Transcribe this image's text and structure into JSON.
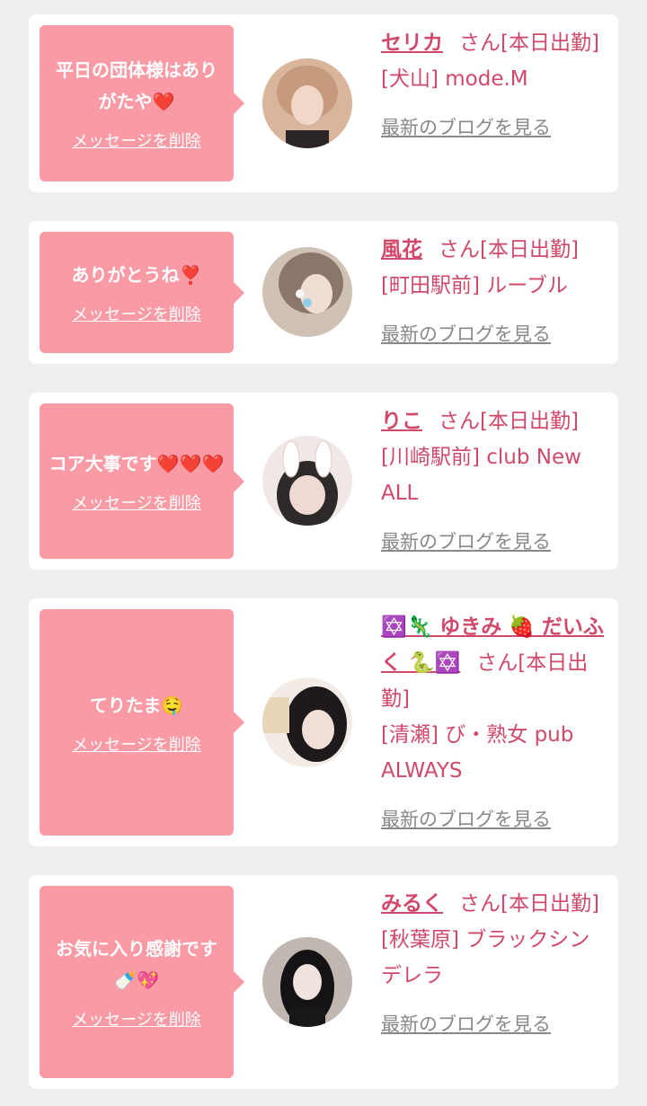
{
  "cards": [
    {
      "message": "平日の団体様はありがたや❤️",
      "delete_label": "メッセージを削除",
      "name": "セリカ",
      "suffix": "さん[本日出勤]",
      "shop": "[犬山] mode.M",
      "blog_label": "最新のブログを見る",
      "avatar_colors": [
        "#d9b59c",
        "#5a4a44"
      ]
    },
    {
      "message": "ありがとうね❣️",
      "delete_label": "メッセージを削除",
      "name": "風花",
      "suffix": "さん[本日出勤]",
      "shop": "[町田駅前] ルーブル",
      "blog_label": "最新のブログを見る",
      "avatar_colors": [
        "#cfc2b5",
        "#7b6a60"
      ]
    },
    {
      "message": "コア大事です❤️❤️❤️",
      "delete_label": "メッセージを削除",
      "name": "りこ",
      "suffix": "さん[本日出勤]",
      "shop": "[川崎駅前] club New ALL",
      "blog_label": "最新のブログを見る",
      "avatar_colors": [
        "#efe8e6",
        "#2f2a2a"
      ]
    },
    {
      "message": "てりたま🤤",
      "delete_label": "メッセージを削除",
      "name": "✡️🦎 ゆきみ 🍓 だいふく 🐍✡️",
      "suffix": "さん[本日出勤]",
      "shop": "[清瀬] び・熟女 pub ALWAYS",
      "blog_label": "最新のブログを見る",
      "avatar_colors": [
        "#f3ece6",
        "#1e1a1c"
      ]
    },
    {
      "message": "お気に入り感謝です🍼💖",
      "delete_label": "メッセージを削除",
      "name": "みるく",
      "suffix": "さん[本日出勤]",
      "shop": "[秋葉原] ブラックシンデレラ",
      "blog_label": "最新のブログを見る",
      "avatar_colors": [
        "#bfb7b0",
        "#141214"
      ]
    }
  ]
}
